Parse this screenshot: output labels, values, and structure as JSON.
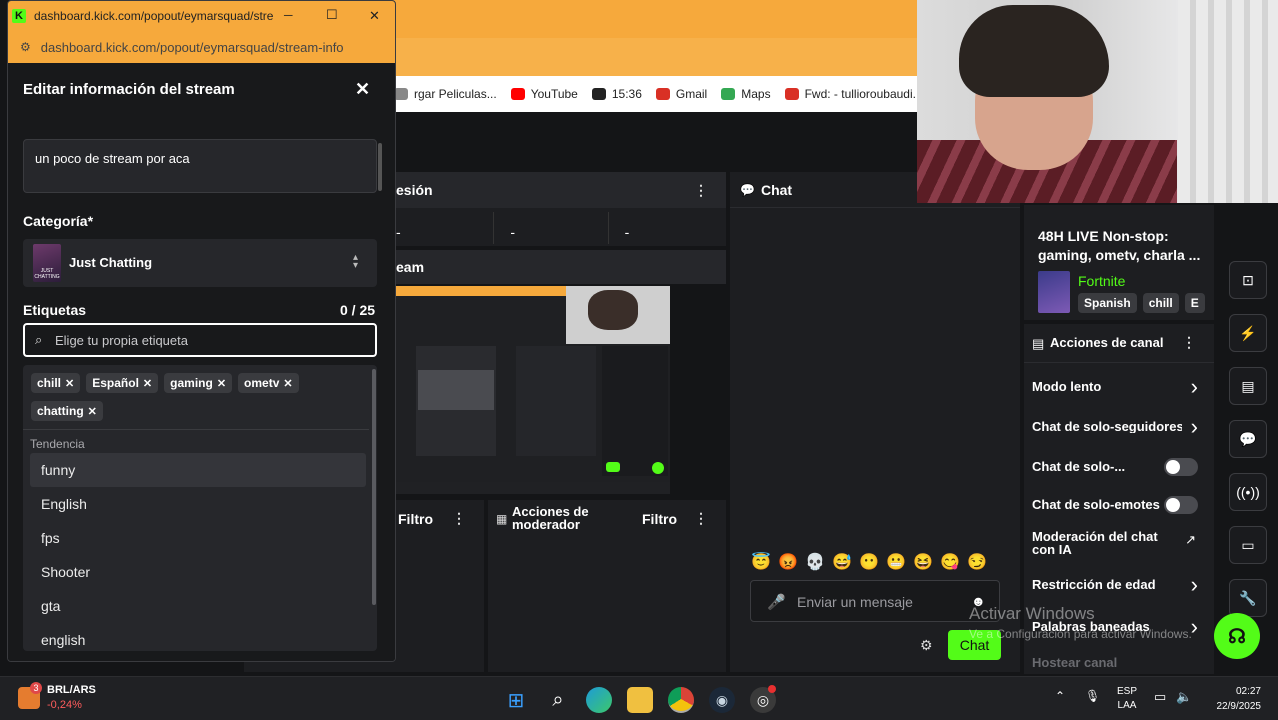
{
  "popout": {
    "title": "dashboard.kick.com/popout/eymarsquad/stre...",
    "url": "dashboard.kick.com/popout/eymarsquad/stream-info",
    "minimize_glyph": "─",
    "maximize_glyph": "☐",
    "close_glyph": "✕"
  },
  "modal": {
    "heading": "Editar información del stream",
    "close_glyph": "✕",
    "stream_title": "un poco de stream por aca",
    "category_label": "Categoría*",
    "category_value": "Just Chatting",
    "category_thumb_text": "JUST\nCHATTING",
    "tags_label": "Etiquetas",
    "tags_count": "0 / 25",
    "tag_input_placeholder": "Elige tu propia etiqueta",
    "selected_tags": [
      "chill",
      "Español",
      "gaming",
      "ometv",
      "chatting"
    ],
    "trending_label": "Tendencia",
    "trending": [
      "funny",
      "English",
      "fps",
      "Shooter",
      "gta",
      "english"
    ]
  },
  "bookmarks": [
    {
      "label": "rgar Peliculas...",
      "icon": "page-icon",
      "color": "#888888"
    },
    {
      "label": "YouTube",
      "icon": "youtube-icon",
      "color": "#ff0000"
    },
    {
      "label": "15:36",
      "icon": "globe-icon",
      "color": "#222222"
    },
    {
      "label": "Gmail",
      "icon": "gmail-icon",
      "color": "#d93025"
    },
    {
      "label": "Maps",
      "icon": "maps-icon",
      "color": "#34a853"
    },
    {
      "label": "Fwd: - tullioroubaudi...",
      "icon": "gmail-icon",
      "color": "#d93025"
    }
  ],
  "dashboard": {
    "session_header": "esión",
    "session_stats": [
      "-",
      "-",
      "-"
    ],
    "stream_header": "eam",
    "filter_label": "Filtro",
    "mod_actions_title": "Acciones de moderador",
    "mod_filter_label": "Filtro"
  },
  "chat": {
    "header": "Chat",
    "input_placeholder": "Enviar un mensaje",
    "send_button": "Chat",
    "emotes": [
      "😇",
      "😡",
      "💀",
      "😅",
      "😶",
      "😬",
      "😆",
      "😋",
      "😏"
    ]
  },
  "stream_info": {
    "title": "48H LIVE Non-stop: gaming, ometv, charla ...",
    "category": "Fortnite",
    "tags": [
      "Spanish",
      "chill",
      "E"
    ]
  },
  "channel_actions": {
    "header": "Acciones de canal",
    "items": [
      {
        "label": "Modo lento",
        "control": "chevron"
      },
      {
        "label": "Chat de solo-seguidores",
        "control": "chevron"
      },
      {
        "label": "Chat de solo-...",
        "control": "toggle"
      },
      {
        "label": "Chat de solo-emotes",
        "control": "toggle"
      },
      {
        "label": "Moderación del chat con IA",
        "control": "external"
      },
      {
        "label": "Restricción de edad",
        "control": "chevron"
      },
      {
        "label": "Palabras baneadas",
        "control": "chevron"
      },
      {
        "label": "Hostear canal",
        "control": "none"
      }
    ]
  },
  "watermark": {
    "line1": "Activar Windows",
    "line2": "Ve a Configuración para activar Windows."
  },
  "taskbar": {
    "ticker_badge": "3",
    "ticker_name": "BRL/ARS",
    "ticker_change": "-0,24%",
    "lang_top": "ESP",
    "lang_bottom": "LAA",
    "time": "02:27",
    "date": "22/9/2025"
  },
  "colors": {
    "kick_green": "#53fc18",
    "chrome_orange": "#f6a93c",
    "negative_red": "#ff5c5c"
  }
}
